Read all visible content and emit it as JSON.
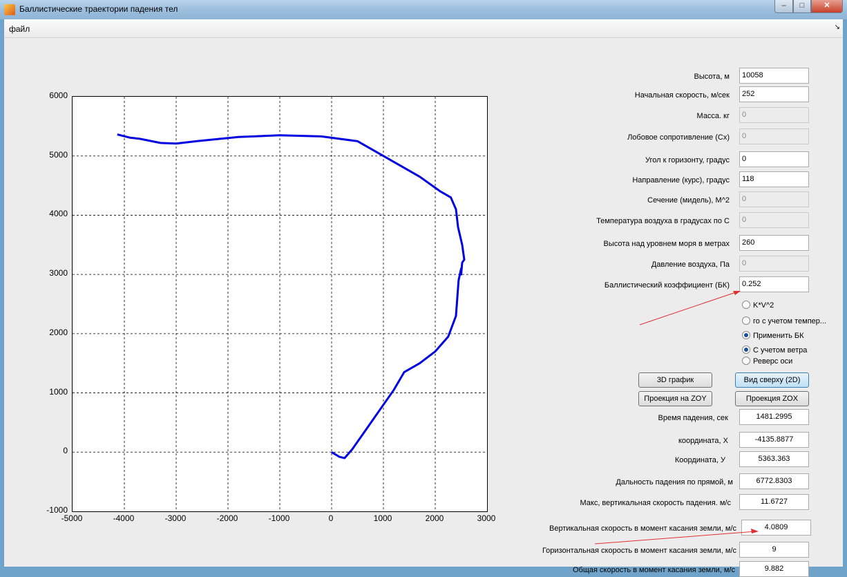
{
  "window": {
    "title": "Баллистические траектории падения тел"
  },
  "menu": {
    "file": "файл",
    "corner": "↘"
  },
  "inputs": [
    {
      "label": "Высота, м",
      "value": "10058",
      "enabled": true
    },
    {
      "label": "Начальная скорость, м/сек",
      "value": "252",
      "enabled": true
    },
    {
      "label": "Масса. кг",
      "value": "0",
      "enabled": false
    },
    {
      "label": "Лобовое сопротивление (Сх)",
      "value": "0",
      "enabled": false
    },
    {
      "label": "Угол к горизонту, градус",
      "value": "0",
      "enabled": true
    },
    {
      "label": "Направление  (курс), градус",
      "value": "118",
      "enabled": true
    },
    {
      "label": "Сечение (мидель), М^2",
      "value": "0",
      "enabled": false
    },
    {
      "label": "Температура воздуха в градусах по С",
      "value": "0",
      "enabled": false
    },
    {
      "label": "Высота над уровнем моря в метрах",
      "value": "260",
      "enabled": true
    },
    {
      "label": "Давление воздуха, Па",
      "value": "0",
      "enabled": false
    },
    {
      "label": "Баллистический коэффициент (БК)",
      "value": "0.252",
      "enabled": true
    }
  ],
  "radios": [
    {
      "label": "K*V^2",
      "checked": false
    },
    {
      "label": "го с учетом темпер...",
      "checked": false
    },
    {
      "label": "Применить БК",
      "checked": true
    },
    {
      "label": "С учетом ветра",
      "checked": true
    },
    {
      "label": "Реверс оси",
      "checked": false
    }
  ],
  "buttons": {
    "graph3d": "3D график",
    "top_view": "Вид сверху (2D)",
    "proj_zoy": "Проекция на ZOY",
    "proj_zox": "Проекция ZOX"
  },
  "outputs": [
    {
      "label": "Время падения, сек",
      "value": "1481.2995"
    },
    {
      "label": "координата, X",
      "value": "-4135.8877"
    },
    {
      "label": "Координата, У",
      "value": "5363.363"
    },
    {
      "label": "Дальность падения по прямой, м",
      "value": "6772.8303"
    },
    {
      "label": "Макс,  вертикальная скорость падения. м/с",
      "value": "11.6727"
    },
    {
      "label": "Вертикальная  скорость в момент касания земли, м/с",
      "value": "4.0809"
    },
    {
      "label": "Горизонтальная скорость в момент касания земли, м/с",
      "value": "9"
    },
    {
      "label": "Общая скорость в момент касания земли, м/с",
      "value": "9.882"
    }
  ],
  "chart_data": {
    "type": "line",
    "title": "",
    "xlabel": "",
    "ylabel": "",
    "xlim": [
      -5000,
      3000
    ],
    "ylim": [
      -1000,
      6000
    ],
    "xticks": [
      "-5000",
      "-4000",
      "-3000",
      "-2000",
      "-1000",
      "0",
      "1000",
      "2000",
      "3000"
    ],
    "yticks": [
      "6000",
      "5000",
      "4000",
      "3000",
      "2000",
      "1000",
      "0",
      "-1000"
    ],
    "grid": true,
    "series": [
      {
        "color": "#0000e0",
        "x": [
          0,
          150,
          250,
          400,
          600,
          800,
          1000,
          1200,
          1400,
          1700,
          2000,
          2250,
          2400,
          2450,
          2500,
          2500,
          2520,
          2560,
          2520,
          2440,
          2400,
          2300,
          2100,
          1700,
          1300,
          900,
          500,
          -200,
          -1000,
          -1800,
          -2600,
          -3000,
          -3300,
          -3700,
          -3900,
          -4136
        ],
        "y": [
          0,
          -80,
          -100,
          50,
          300,
          550,
          800,
          1050,
          1350,
          1500,
          1700,
          1950,
          2300,
          2900,
          3100,
          3000,
          3200,
          3250,
          3500,
          3800,
          4100,
          4300,
          4400,
          4650,
          4850,
          5050,
          5250,
          5330,
          5350,
          5320,
          5250,
          5210,
          5220,
          5290,
          5310,
          5363
        ]
      }
    ]
  },
  "annotations": {
    "arrow_color": "#e03030"
  }
}
